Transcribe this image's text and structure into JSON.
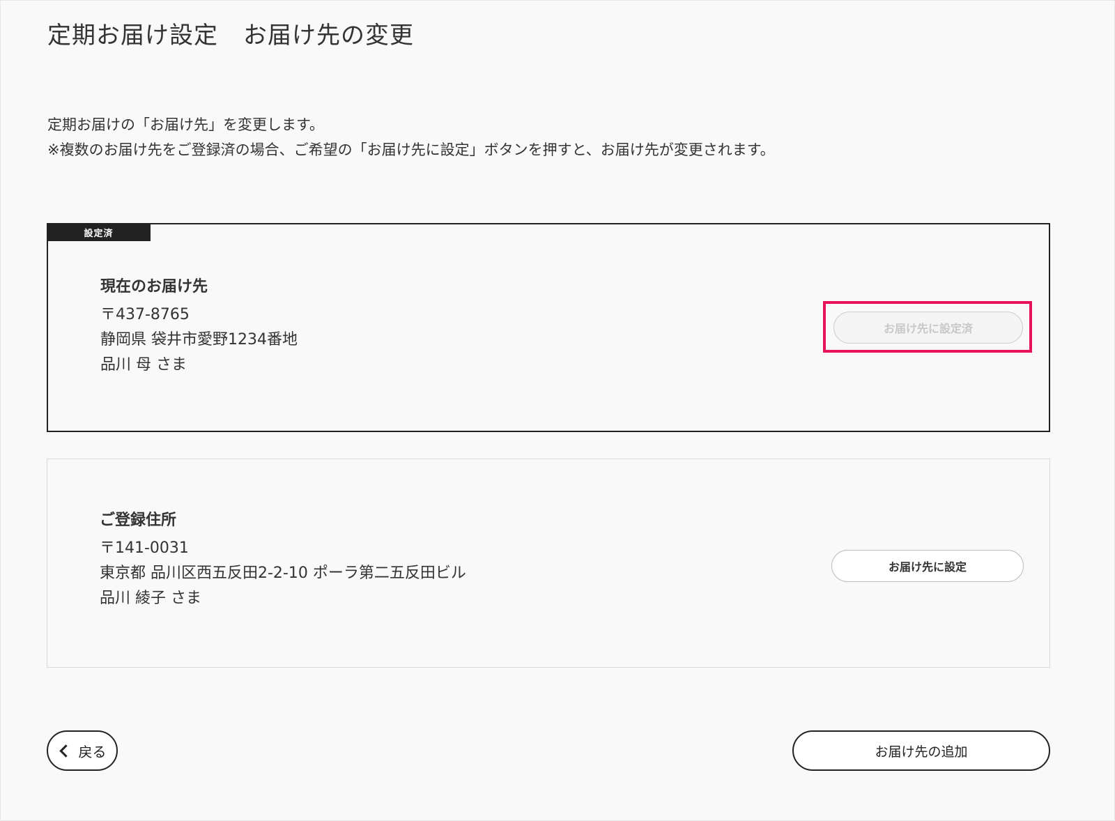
{
  "page": {
    "title_part1": "定期お届け設定",
    "title_part2": "お届け先の変更",
    "lead_line1": "定期お届けの「お届け先」を変更します。",
    "lead_line2": "※複数のお届け先をご登録済の場合、ご希望の「お届け先に設定」ボタンを押すと、お届け先が変更されます。"
  },
  "current": {
    "badge": "設定済",
    "heading": "現在のお届け先",
    "postal": "〒437-8765",
    "address": "静岡県 袋井市愛野1234番地",
    "name": "品川 母 さま",
    "button_label": "お届け先に設定済",
    "highlight_color": "#e8115a"
  },
  "registered": {
    "heading": "ご登録住所",
    "postal": "〒141-0031",
    "address": "東京都 品川区西五反田2-2-10 ポーラ第二五反田ビル",
    "name": "品川 綾子 さま",
    "button_label": "お届け先に設定"
  },
  "footer": {
    "back_label": "戻る",
    "back_icon": "chevron-left-icon",
    "add_label": "お届け先の追加"
  }
}
